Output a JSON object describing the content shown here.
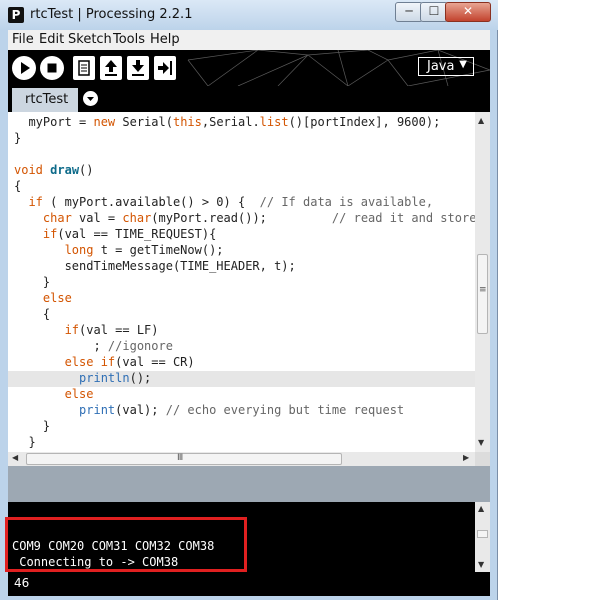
{
  "window": {
    "title": "rtcTest | Processing 2.2.1",
    "app_icon": "P",
    "controls": {
      "minimize": "─",
      "maximize": "☐",
      "close": "✕"
    }
  },
  "menu": [
    "File",
    "Edit",
    "Sketch",
    "Tools",
    "Help"
  ],
  "toolbar": {
    "buttons": [
      "run-icon",
      "stop-icon",
      "new-icon",
      "open-icon",
      "save-icon",
      "export-icon"
    ],
    "mode": "Java",
    "mode_caret": "▼"
  },
  "tabs": [
    "rtcTest"
  ],
  "editor": {
    "lines": [
      [
        [
          "",
          "  myPort = "
        ],
        [
          "kw-orange",
          "new"
        ],
        [
          "",
          " Serial("
        ],
        [
          "kw-orange",
          "this"
        ],
        [
          "",
          ",Serial."
        ],
        [
          "kw-orange",
          "list"
        ],
        [
          "",
          "()[portIndex], 9600);"
        ]
      ],
      [
        [
          "",
          "}"
        ]
      ],
      [
        [
          "",
          ""
        ]
      ],
      [
        [
          "kw-orange",
          "void"
        ],
        [
          "",
          " "
        ],
        [
          "kw-bold",
          "draw"
        ],
        [
          "",
          "()"
        ]
      ],
      [
        [
          "",
          "{"
        ]
      ],
      [
        [
          "",
          "  "
        ],
        [
          "kw-orange",
          "if"
        ],
        [
          "",
          " ( myPort.available() > 0) {  "
        ],
        [
          "cm",
          "// If data is available,"
        ]
      ],
      [
        [
          "",
          "    "
        ],
        [
          "kw-orange",
          "char"
        ],
        [
          "",
          " val = "
        ],
        [
          "kw-orange",
          "char"
        ],
        [
          "",
          "(myPort.read());         "
        ],
        [
          "cm",
          "// read it and store i"
        ]
      ],
      [
        [
          "",
          "    "
        ],
        [
          "kw-orange",
          "if"
        ],
        [
          "",
          "(val == TIME_REQUEST){"
        ]
      ],
      [
        [
          "",
          "       "
        ],
        [
          "kw-orange",
          "long"
        ],
        [
          "",
          " t = getTimeNow();"
        ]
      ],
      [
        [
          "",
          "       sendTimeMessage(TIME_HEADER, t);"
        ]
      ],
      [
        [
          "",
          "    }"
        ]
      ],
      [
        [
          "",
          "    "
        ],
        [
          "kw-orange",
          "else"
        ]
      ],
      [
        [
          "",
          "    {"
        ]
      ],
      [
        [
          "",
          "       "
        ],
        [
          "kw-orange",
          "if"
        ],
        [
          "",
          "(val == LF)"
        ]
      ],
      [
        [
          "",
          "           ; "
        ],
        [
          "cm",
          "//igonore"
        ]
      ],
      [
        [
          "",
          "       "
        ],
        [
          "kw-orange",
          "else if"
        ],
        [
          "",
          "(val == CR)"
        ]
      ],
      [
        [
          "",
          "         "
        ],
        [
          "kw-blue",
          "println"
        ],
        [
          "",
          "();"
        ]
      ],
      [
        [
          "",
          "       "
        ],
        [
          "kw-orange",
          "else"
        ]
      ],
      [
        [
          "",
          "         "
        ],
        [
          "kw-blue",
          "print"
        ],
        [
          "",
          "(val); "
        ],
        [
          "cm",
          "// echo everying but time request"
        ]
      ],
      [
        [
          "",
          "    }"
        ]
      ],
      [
        [
          "",
          "  }"
        ]
      ]
    ],
    "highlighted_line": 16
  },
  "console": {
    "lines": [
      "",
      "",
      "COM9 COM20 COM31 COM32 COM38",
      " Connecting to -> COM38"
    ]
  },
  "status": {
    "line_number": "46"
  },
  "scrollbar": {
    "grip": "≡",
    "hgrip": "Ⅲ",
    "up": "▲",
    "down": "▼",
    "left": "◀",
    "right": "▶"
  },
  "colors": {
    "highlight_box": "#e02020",
    "keyword": "#d35400",
    "builtin": "#2f6fb5",
    "comment": "#666666"
  }
}
